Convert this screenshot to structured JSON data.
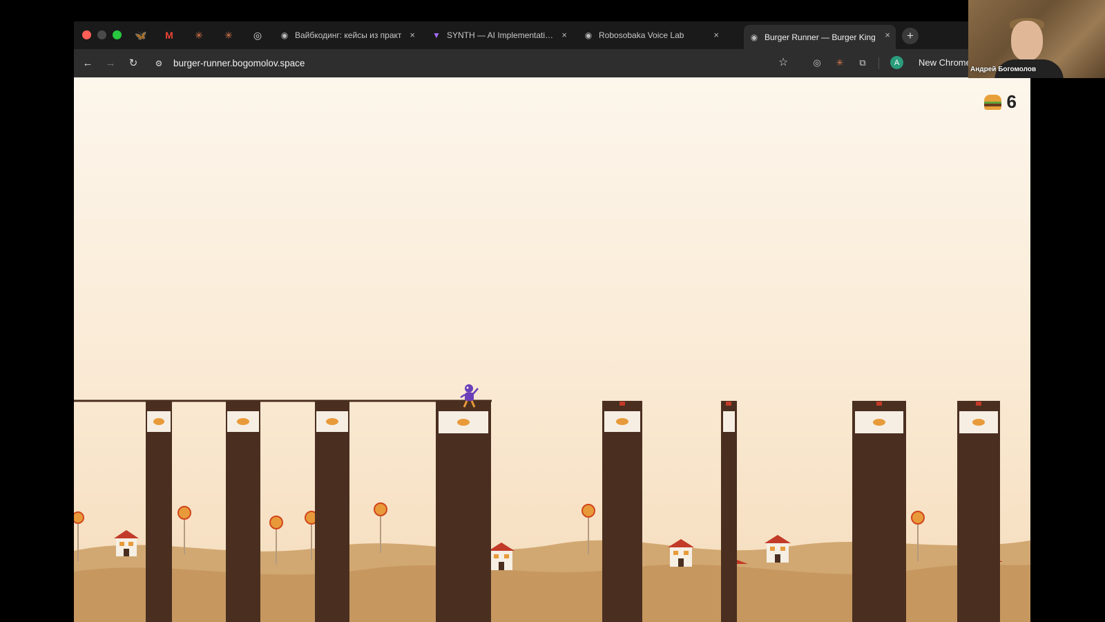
{
  "browser": {
    "pinned_tabs": [
      {
        "icon": "butterfly-icon",
        "glyph": "🦋"
      },
      {
        "icon": "gmail-icon",
        "glyph": "M"
      },
      {
        "icon": "sparkle-icon",
        "glyph": "✳"
      },
      {
        "icon": "sparkle-icon",
        "glyph": "✳"
      },
      {
        "icon": "openai-icon",
        "glyph": "◎"
      }
    ],
    "tabs": [
      {
        "title": "Вайбкодинг: кейсы из практ",
        "icon": "globe-icon",
        "active": false
      },
      {
        "title": "SYNTH — AI Implementation",
        "icon": "synth-icon",
        "active": false
      },
      {
        "title": "Robosobaka Voice Lab",
        "icon": "globe-icon",
        "active": false
      },
      {
        "title": "Burger Runner — Burger King",
        "icon": "globe-icon",
        "active": true
      }
    ],
    "new_tab_label": "+",
    "close_label": "×",
    "url": "burger-runner.bogomolov.space",
    "profile_initial": "A",
    "new_chrome_label": "New Chrome"
  },
  "game": {
    "score_icon": "burger-icon",
    "score": "6",
    "colors": {
      "sky_top": "#fcf6ec",
      "sky_bottom": "#f5dcbb",
      "pillar": "#4a2f20",
      "sign_band": "#f6eee2",
      "bk_logo": "#e89a3a",
      "bk_ring": "#d0451b",
      "ground": "#c79a62",
      "house_roof": "#c23a28",
      "house_wall": "#f5efe4",
      "player": "#6a3fb8"
    }
  },
  "webcam": {
    "name": "Андрей Богомолов"
  }
}
